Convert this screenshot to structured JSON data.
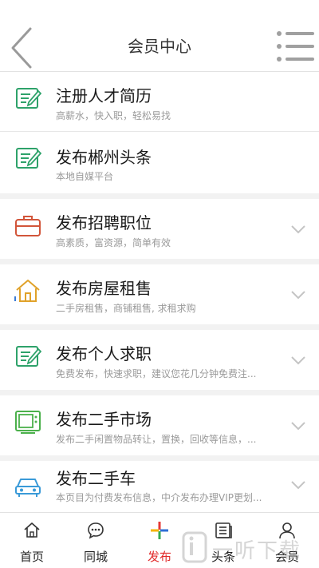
{
  "header": {
    "title": "会员中心"
  },
  "items": [
    {
      "title": "注册人才简历",
      "subtitle": "高薪水，快入职，轻松易找",
      "icon": "resume-edit-icon",
      "color": "#2ea26a"
    },
    {
      "title": "发布郴州头条",
      "subtitle": "本地自媒平台",
      "icon": "news-edit-icon",
      "color": "#2ea26a"
    },
    {
      "title": "发布招聘职位",
      "subtitle": "高素质，富资源，简单有效",
      "icon": "briefcase-icon",
      "color": "#d2553a"
    },
    {
      "title": "发布房屋租售",
      "subtitle": "二手房租售，商铺租售, 求租求购",
      "icon": "house-icon",
      "color": "#e0a22a"
    },
    {
      "title": "发布个人求职",
      "subtitle": "免费发布，快速求职，建议您花几分钟免费注...",
      "icon": "resume-edit-icon",
      "color": "#2ea26a"
    },
    {
      "title": "发布二手市场",
      "subtitle": "发布二手闲置物品转让，置换，回收等信息，...",
      "icon": "tv-icon",
      "color": "#4bb04b"
    },
    {
      "title": "发布二手车",
      "subtitle": "本页目为付费发布信息，中介发布办理VIP更划...",
      "icon": "car-icon",
      "color": "#3a9ad8"
    }
  ],
  "tabs": [
    {
      "label": "首页",
      "icon": "home-icon"
    },
    {
      "label": "同城",
      "icon": "chat-bubble-icon"
    },
    {
      "label": "发布",
      "icon": "plus-icon"
    },
    {
      "label": "头条",
      "icon": "newspaper-icon"
    },
    {
      "label": "会员",
      "icon": "user-icon"
    }
  ],
  "active_tab": "发布",
  "watermark": {
    "text": "一听下载"
  },
  "colors": {
    "accent": "#e12a2a",
    "plus_red": "#e53935",
    "plus_blue": "#2f6fd6",
    "plus_green": "#34a853",
    "plus_yellow": "#f4b400"
  }
}
